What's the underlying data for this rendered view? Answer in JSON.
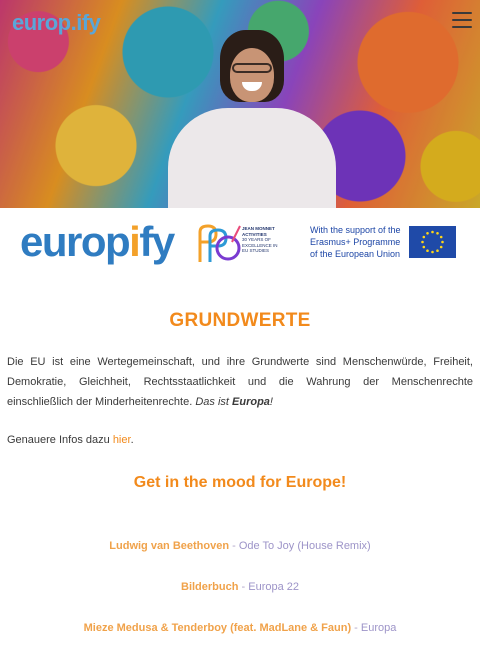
{
  "header": {
    "brand": "europ.ify",
    "menu_icon": "hamburger-menu-icon"
  },
  "logos": {
    "europify_main": "europ",
    "europify_accent": "i",
    "europify_end": "fy",
    "jean_monnet": "JEAN MONNET ACTIVITIES",
    "jean_monnet_sub": "30 YEARS OF EXCELLENCE IN EU STUDIES",
    "erasmus": "With the support of the Erasmus+ Programme of the European Union"
  },
  "main": {
    "title": "GRUNDWERTE",
    "paragraph": "Die EU ist eine Wertegemeinschaft, und ihre Grundwerte sind Menschenwürde, Freiheit, Demokratie, Gleichheit, Rechtsstaatlichkeit und die Wahrung der Menschenrechte einschließlich der Minderheitenrechte.",
    "paragraph_em": "Das ist",
    "paragraph_strong": "Europa",
    "paragraph_end": "!",
    "info_text": "Genauere Infos dazu",
    "info_link": "hier",
    "info_end": ".",
    "mood": "Get in the mood for Europe!"
  },
  "songs": [
    {
      "artist": "Ludwig van Beethoven",
      "separator": " - ",
      "track": "Ode To Joy (House Remix)"
    },
    {
      "artist": "Bilderbuch",
      "separator": " - ",
      "track": "Europa 22"
    },
    {
      "artist": "Mieze Medusa & Tenderboy (feat. MadLane & Faun)",
      "separator": " - ",
      "track": "Europa"
    }
  ],
  "colors": {
    "accent_orange": "#f28a1c",
    "brand_blue": "#2f7cc1",
    "track_lilac": "#9d94c8"
  }
}
